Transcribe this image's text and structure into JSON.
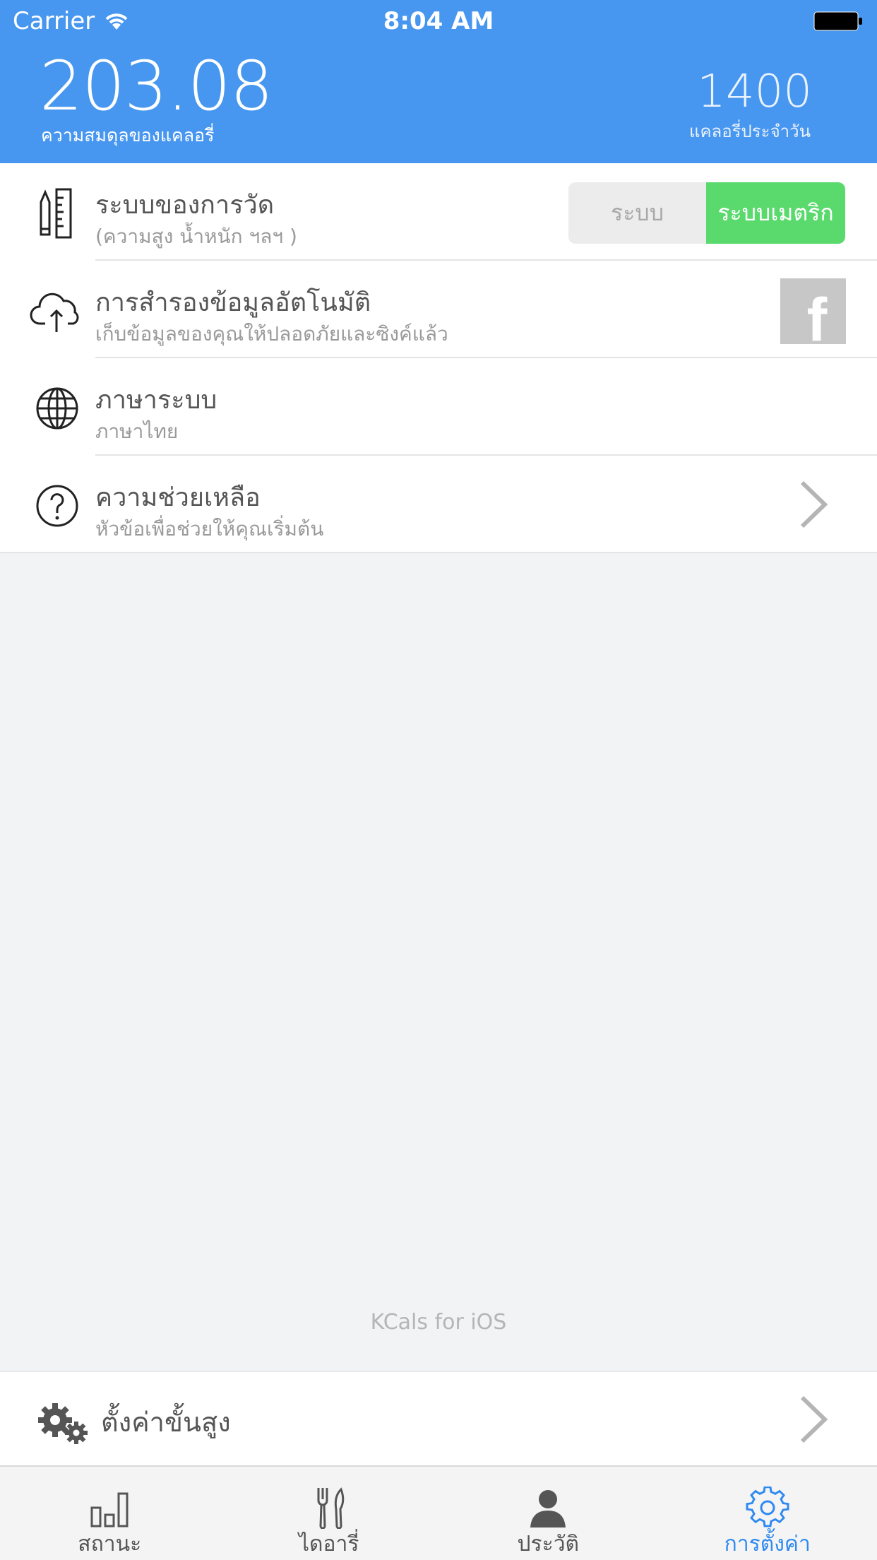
{
  "status_bar": {
    "carrier": "Carrier",
    "time": "8:04 AM"
  },
  "header": {
    "balance_value": "203.08",
    "balance_label": "ความสมดุลของแคลอรี่",
    "daily_value": "1400",
    "daily_label": "แคลอรี่ประจำวัน"
  },
  "settings": {
    "units": {
      "title": "ระบบของการวัด",
      "subtitle": "(ความสูง น้ำหนัก ฯลฯ )",
      "option_left": "ระบบ",
      "option_right": "ระบบเมตริก",
      "selected": "ระบบเมตริก"
    },
    "backup": {
      "title": "การสำรองข้อมูลอัตโนมัติ",
      "subtitle": "เก็บข้อมูลของคุณให้ปลอดภัยและซิงค์แล้ว",
      "fb_glyph": "f"
    },
    "language": {
      "title": "ภาษาระบบ",
      "subtitle": "ภาษาไทย"
    },
    "help": {
      "title": "ความช่วยเหลือ",
      "subtitle": "หัวข้อเพื่อช่วยให้คุณเริ่มต้น"
    }
  },
  "footer_caption": "KCals for iOS",
  "advanced": {
    "label": "ตั้งค่าขั้นสูง"
  },
  "tabs": [
    {
      "label": "สถานะ",
      "icon": "bar-chart-icon"
    },
    {
      "label": "ไดอารี่",
      "icon": "fork-knife-icon"
    },
    {
      "label": "ประวัติ",
      "icon": "person-icon"
    },
    {
      "label": "การตั้งค่า",
      "icon": "gear-icon",
      "active": true
    }
  ],
  "colors": {
    "header": "#4796ef",
    "toggle_on": "#5ad96d",
    "active_tab": "#2f8af0"
  }
}
